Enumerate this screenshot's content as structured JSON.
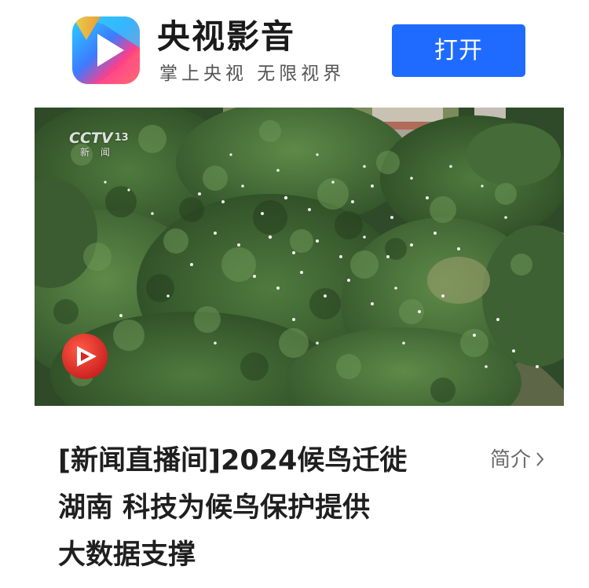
{
  "app_banner": {
    "app_name": "央视影音",
    "slogan": "掌上央视  无限视界",
    "open_button_label": "打开",
    "logo_icon": "cctv-video-play-logo-icon",
    "accent_color": "#1f6bff"
  },
  "video": {
    "channel_logo": "CCTV",
    "channel_number": "13",
    "channel_sub": "新闻",
    "play_icon": "play-badge-icon",
    "play_color": "#e8322b"
  },
  "content": {
    "title_lines": [
      "[新闻直播间]2024候鸟迁徙",
      "湖南 科技为候鸟保护提供",
      "大数据支撑"
    ],
    "intro_label": "简介",
    "intro_icon": "chevron-right-icon"
  }
}
